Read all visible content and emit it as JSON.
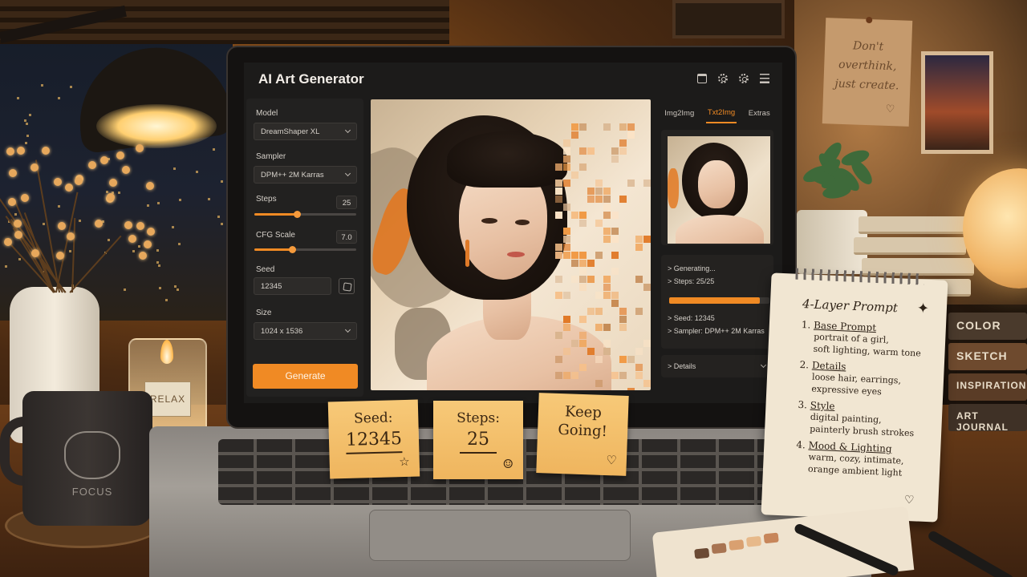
{
  "app": {
    "title": "AI Art Generator",
    "icons": [
      "folder-icon",
      "gear-icon",
      "settings-icon",
      "menu-icon"
    ]
  },
  "controls": {
    "model": {
      "label": "Model",
      "value": "DreamShaper XL"
    },
    "sampler": {
      "label": "Sampler",
      "value": "DPM++ 2M Karras"
    },
    "steps": {
      "label": "Steps",
      "value": "25",
      "fraction": 0.42
    },
    "cfg": {
      "label": "CFG Scale",
      "value": "7.0",
      "fraction": 0.37
    },
    "seed": {
      "label": "Seed",
      "value": "12345"
    },
    "size": {
      "label": "Size",
      "value": "1024 x 1536"
    },
    "generate_label": "Generate"
  },
  "right_panel": {
    "tabs": [
      {
        "label": "Img2Img",
        "active": false
      },
      {
        "label": "Txt2Img",
        "active": true
      },
      {
        "label": "Extras",
        "active": false
      }
    ],
    "log": {
      "line1": "> Generating...",
      "line2": "> Steps: 25/25",
      "progress": 0.9,
      "line3": "> Seed: 12345",
      "line4": "> Sampler: DPM++ 2M Karras"
    },
    "details_label": "> Details"
  },
  "desk": {
    "sticky_seed": {
      "label": "Seed:",
      "value": "12345"
    },
    "sticky_steps": {
      "label": "Steps:",
      "value": "25"
    },
    "sticky_keep": {
      "line1": "Keep",
      "line2": "Going!"
    },
    "wall_note": {
      "line1": "Don't",
      "line2": "overthink,",
      "line3": "just create."
    },
    "mug_text": "FOCUS",
    "candle_text": "RELAX",
    "book_spines": [
      "COLOR",
      "SKETCH",
      "INSPIRATION",
      "ART JOURNAL"
    ]
  },
  "notepad": {
    "title": "4-Layer Prompt",
    "items": [
      {
        "num": "1.",
        "head": "Base Prompt",
        "body1": "portrait of a girl,",
        "body2": "soft lighting, warm tone"
      },
      {
        "num": "2.",
        "head": "Details",
        "body1": "loose hair, earrings,",
        "body2": "expressive eyes"
      },
      {
        "num": "3.",
        "head": "Style",
        "body1": "digital painting,",
        "body2": "painterly brush strokes"
      },
      {
        "num": "4.",
        "head": "Mood & Lighting",
        "body1": "warm, cozy, intimate,",
        "body2": "orange ambient light"
      }
    ]
  },
  "colors": {
    "accent": "#f08a24",
    "panel": "#222120",
    "screen": "#1c1b1a"
  }
}
